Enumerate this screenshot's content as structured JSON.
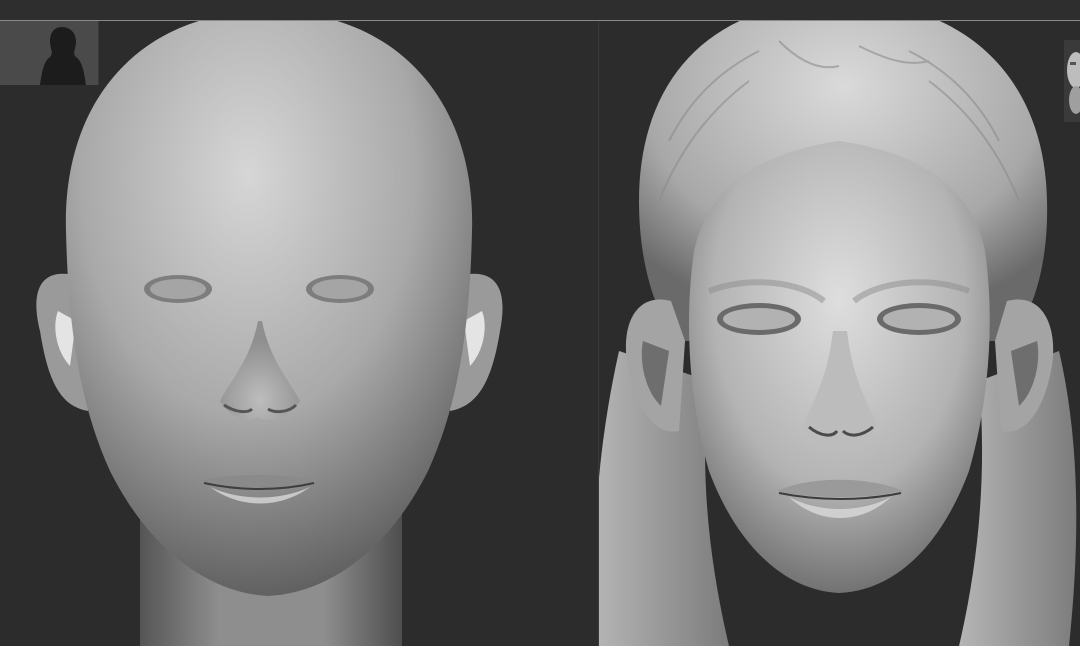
{
  "app": {
    "window_title": ""
  },
  "viewports": [
    {
      "name": "left-viewport",
      "model": "bald-female-head-sculpt"
    },
    {
      "name": "right-viewport",
      "model": "female-head-with-hair-sculpt"
    }
  ],
  "thumbnails": {
    "left_icon": "silhouette-icon",
    "right_icon": "head-thumbnail-icon"
  },
  "colors": {
    "background": "#2b2b2b",
    "clay": "#a8a8a8",
    "clay_light": "#d2d2d2",
    "clay_dark": "#5e5e5e"
  }
}
